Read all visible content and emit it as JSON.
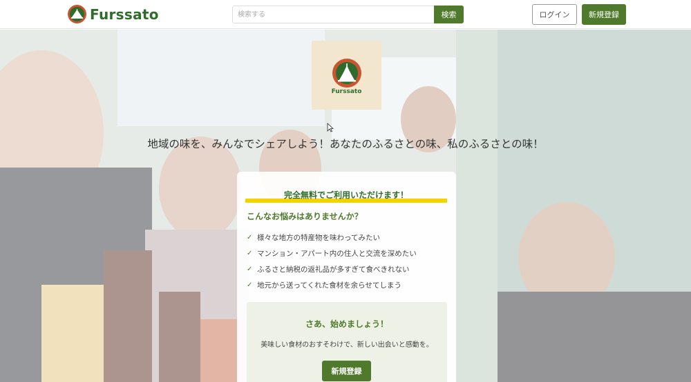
{
  "header": {
    "logo_text": "Furssato",
    "search_placeholder": "検索する",
    "search_button": "検索",
    "login_button": "ログイン",
    "signup_button": "新規登録"
  },
  "hero": {
    "logo_name": "Furssato",
    "tagline": "地域の味を、みんなでシェアしよう！あなたのふるさとの味、私のふるさとの味！"
  },
  "card": {
    "free_title": "完全無料でご利用いただけます！",
    "worries_title": "こんなお悩みはありませんか？",
    "worries": [
      "様々な地方の特産物を味わってみたい",
      "マンション・アパート内の住人と交流を深めたい",
      "ふるさと納税の返礼品が多すぎて食べきれない",
      "地元から送ってくれた食材を余らせてしまう"
    ],
    "start_title": "さあ、始めましょう！",
    "start_desc": "美味しい食材のおすそわけで、新しい出会いと感動を。",
    "cta_button": "新規登録"
  },
  "colors": {
    "brand_green": "#4f7a2b",
    "logo_green": "#2e6e2a",
    "logo_orange": "#c7552f",
    "highlight_yellow": "#f2d300"
  },
  "icons": [
    "logo-icon",
    "check-icon",
    "cursor-icon"
  ]
}
